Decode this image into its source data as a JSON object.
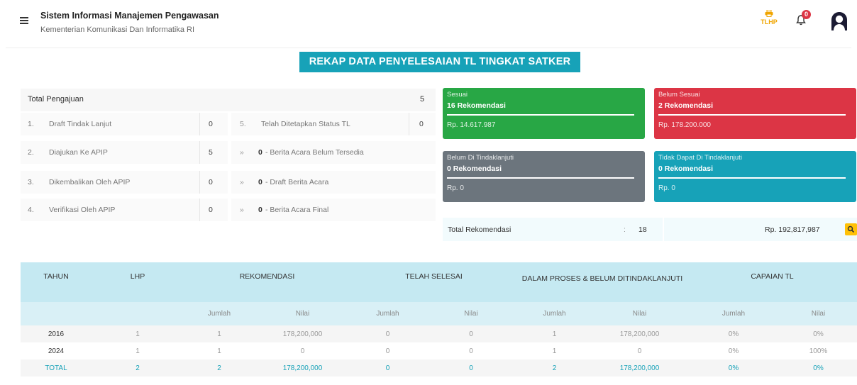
{
  "app": {
    "title": "Sistem Informasi Manajemen Pengawasan",
    "subtitle": "Kementerian Komunikasi Dan Informatika RI"
  },
  "header": {
    "tlhp_label": "TLHP",
    "notification_count": "0"
  },
  "page_heading": "REKAP DATA PENYELESAIAN TL TINGKAT SATKER",
  "pengajuan": {
    "total_label": "Total Pengajuan",
    "total_value": "5",
    "left_items": [
      {
        "no": "1.",
        "label": "Draft Tindak Lanjut",
        "value": "0"
      },
      {
        "no": "2.",
        "label": "Diajukan Ke APIP",
        "value": "5"
      },
      {
        "no": "3.",
        "label": "Dikembalikan Oleh APIP",
        "value": "0"
      },
      {
        "no": "4.",
        "label": "Verifikasi Oleh APIP",
        "value": "0"
      }
    ],
    "right_items": [
      {
        "mark": "5.",
        "value": "",
        "label": "Telah Ditetapkan Status TL",
        "extra": "0"
      },
      {
        "mark": "»",
        "value": "0",
        "label": "- Berita Acara Belum Tersedia"
      },
      {
        "mark": "»",
        "value": "0",
        "label": "- Draft Berita Acara"
      },
      {
        "mark": "»",
        "value": "0",
        "label": "- Berita Acara Final"
      }
    ]
  },
  "cards": [
    {
      "title": "Sesuai",
      "count": "16 Rekomendasi",
      "amount": "Rp. 14.617.987",
      "color": "#28a745"
    },
    {
      "title": "Belum Sesuai",
      "count": "2 Rekomendasi",
      "amount": "Rp. 178.200.000",
      "color": "#dc3545"
    },
    {
      "title": "Belum Di Tindaklanjuti",
      "count": "0 Rekomendasi",
      "amount": "Rp. 0",
      "color": "#6c757d"
    },
    {
      "title": "Tidak Dapat Di Tindaklanjuti",
      "count": "0 Rekomendasi",
      "amount": "Rp. 0",
      "color": "#17a2b8"
    }
  ],
  "total_rekomendasi": {
    "label": "Total Rekomendasi",
    "colon": ":",
    "count": "18",
    "amount": "Rp. 192,817,987"
  },
  "table": {
    "headers": [
      "TAHUN",
      "LHP",
      "REKOMENDASI",
      "TELAH SELESAI",
      "DALAM PROSES & BELUM DITINDAKLANJUTI",
      "CAPAIAN TL"
    ],
    "sub_headers": [
      "Jumlah",
      "Nilai",
      "Jumlah",
      "Nilai",
      "Jumlah",
      "Nilai",
      "Jumlah",
      "Nilai"
    ],
    "rows": [
      [
        "2016",
        "1",
        "1",
        "178,200,000",
        "0",
        "0",
        "1",
        "178,200,000",
        "0%",
        "0%"
      ],
      [
        "2024",
        "1",
        "1",
        "0",
        "0",
        "0",
        "1",
        "0",
        "0%",
        "100%"
      ],
      [
        "TOTAL",
        "2",
        "2",
        "178,200,000",
        "0",
        "0",
        "2",
        "178,200,000",
        "0%",
        "0%"
      ]
    ]
  },
  "colors": {
    "primary": "#17a2b8",
    "success": "#28a745",
    "danger": "#dc3545",
    "secondary": "#6c757d",
    "warning": "#ffc107"
  }
}
